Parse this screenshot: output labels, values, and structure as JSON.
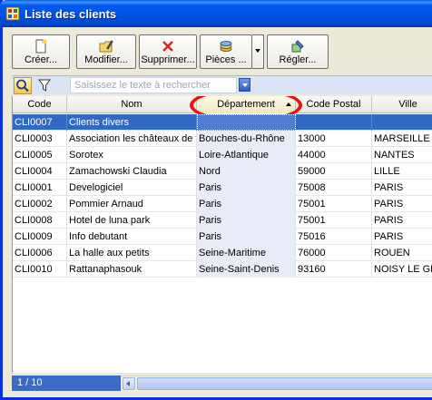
{
  "window": {
    "title": "Liste des clients",
    "icon": "app-grid-icon"
  },
  "toolbar": {
    "buttons": [
      {
        "label": "Créer...",
        "icon": "new-document-icon"
      },
      {
        "label": "Modifier...",
        "icon": "edit-folder-icon"
      },
      {
        "label": "Supprimer...",
        "icon": "delete-x-icon"
      },
      {
        "label": "Pièces ...",
        "icon": "coins-icon"
      },
      {
        "label": "Régler...",
        "icon": "settle-icon"
      }
    ]
  },
  "search": {
    "placeholder": "Saisissez le texte à rechercher",
    "value": ""
  },
  "table": {
    "columns": [
      "Code",
      "Nom",
      "Département",
      "Code Postal",
      "Ville"
    ],
    "sorted_column": "Département",
    "rows": [
      [
        "CLI0007",
        "Clients divers",
        "",
        "",
        ""
      ],
      [
        "CLI0003",
        "Association les châteaux de f",
        "Bouches-du-Rhône",
        "13000",
        "MARSEILLE"
      ],
      [
        "CLI0005",
        "Sorotex",
        "Loire-Atlantique",
        "44000",
        "NANTES"
      ],
      [
        "CLI0004",
        "Zamachowski Claudia",
        "Nord",
        "59000",
        "LILLE"
      ],
      [
        "CLI0001",
        "Develogiciel",
        "Paris",
        "75008",
        "PARIS"
      ],
      [
        "CLI0002",
        "Pommier Arnaud",
        "Paris",
        "75001",
        "PARIS"
      ],
      [
        "CLI0008",
        "Hotel de luna park",
        "Paris",
        "75001",
        "PARIS"
      ],
      [
        "CLI0009",
        "Info debutant",
        "Paris",
        "75016",
        "PARIS"
      ],
      [
        "CLI0006",
        "La halle aux petits",
        "Seine-Maritime",
        "76000",
        "ROUEN"
      ],
      [
        "CLI0010",
        "Rattanaphasouk",
        "Seine-Saint-Denis",
        "93160",
        "NOISY LE GRAND"
      ]
    ],
    "selected_row": 0
  },
  "status": {
    "count": "1 / 10"
  },
  "colors": {
    "selection": "#316ac5",
    "titlebar": "#0054e3",
    "highlight_ring": "#ee1010"
  }
}
